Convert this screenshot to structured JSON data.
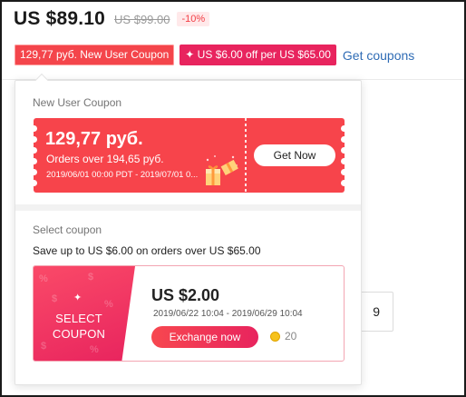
{
  "product": {
    "price": "US $89.10",
    "original_price": "US $99.00",
    "discount": "-10%"
  },
  "coupon_tags": {
    "new_user": "129,77 руб. New User Coupon",
    "store_offer": "✦ US $6.00 off per US $65.00",
    "get_coupons_link": "Get coupons"
  },
  "background": {
    "quantity_value": "9"
  },
  "popover": {
    "new_user_section": {
      "title": "New User Coupon",
      "amount": "129,77 руб.",
      "min_order": "Orders over 194,65 руб.",
      "validity": "2019/06/01 00:00 PDT - 2019/07/01 0...",
      "button_label": "Get Now"
    },
    "select_section": {
      "title": "Select coupon",
      "save_text": "Save up to US $6.00 on orders over US $65.00",
      "card": {
        "left_star": "✦",
        "left_line1": "SELECT",
        "left_line2": "COUPON",
        "amount": "US $2.00",
        "validity": "2019/06/22 10:04 - 2019/06/29 10:04",
        "button_label": "Exchange now",
        "coin_cost": "20"
      }
    }
  },
  "icons": {
    "gift": "gift-icon",
    "coin": "coin-icon",
    "star": "star-icon"
  },
  "colors": {
    "coupon_red": "#f7444b",
    "coupon_pink": "#e8245e",
    "link_blue": "#2f6cb5"
  }
}
